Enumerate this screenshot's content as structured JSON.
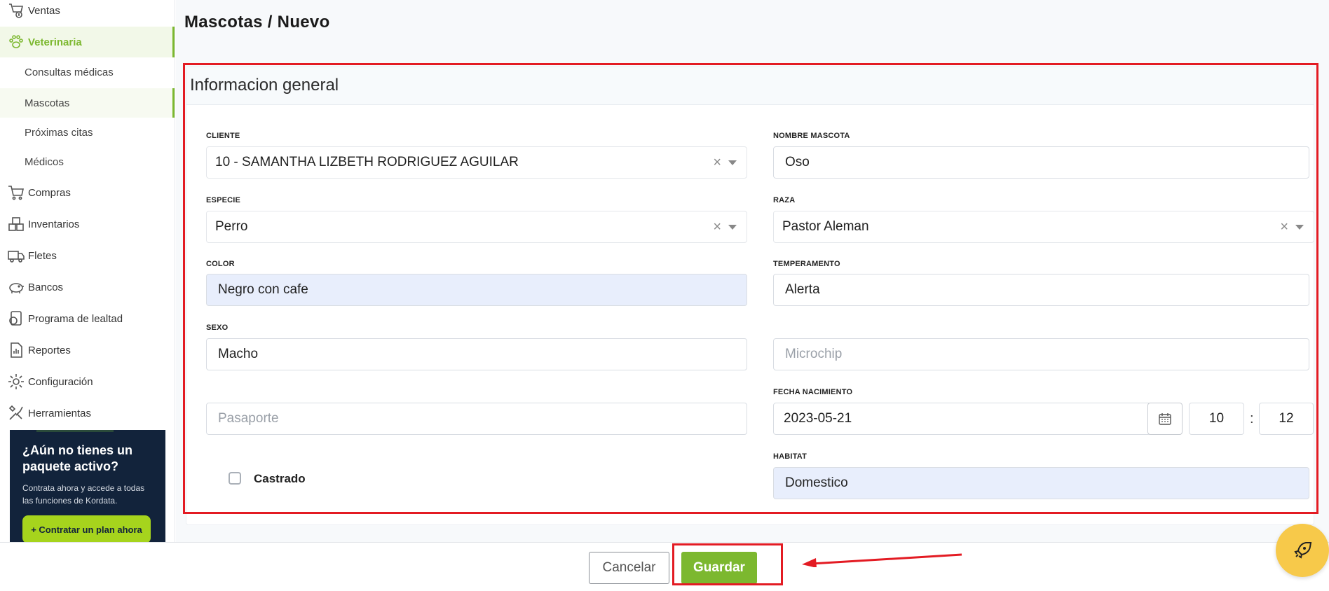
{
  "sidebar": {
    "items": [
      {
        "label": "Ventas",
        "icon": "sales-icon"
      },
      {
        "label": "Veterinaria",
        "icon": "paw-icon"
      },
      {
        "label": "Compras",
        "icon": "cart-icon"
      },
      {
        "label": "Inventarios",
        "icon": "boxes-icon"
      },
      {
        "label": "Fletes",
        "icon": "truck-icon"
      },
      {
        "label": "Bancos",
        "icon": "piggy-bank-icon"
      },
      {
        "label": "Programa de lealtad",
        "icon": "loyalty-icon"
      },
      {
        "label": "Reportes",
        "icon": "report-icon"
      },
      {
        "label": "Configuración",
        "icon": "gear-icon"
      },
      {
        "label": "Herramientas",
        "icon": "tools-icon"
      }
    ],
    "subitems": [
      {
        "label": "Consultas médicas"
      },
      {
        "label": "Mascotas"
      },
      {
        "label": "Próximas citas"
      },
      {
        "label": "Médicos"
      }
    ],
    "promo": {
      "title": "¿Aún no tienes un paquete activo?",
      "text": "Contrata ahora y accede a todas las funciones de Kordata.",
      "cta": "+ Contratar un plan ahora"
    }
  },
  "header": {
    "breadcrumb": "Mascotas /  Nuevo"
  },
  "form": {
    "title": "Informacion general",
    "cliente_label": "CLIENTE",
    "cliente_value": "10 - SAMANTHA LIZBETH RODRIGUEZ AGUILAR",
    "nombre_label": "NOMBRE MASCOTA",
    "nombre_value": "Oso",
    "especie_label": "ESPECIE",
    "especie_value": "Perro",
    "raza_label": "RAZA",
    "raza_value": "Pastor Aleman",
    "color_label": "COLOR",
    "color_value": "Negro con cafe",
    "temperamento_label": "TEMPERAMENTO",
    "temperamento_value": "Alerta",
    "sexo_label": "SEXO",
    "sexo_value": "Macho",
    "microchip_placeholder": "Microchip",
    "pasaporte_placeholder": "Pasaporte",
    "fecha_label": "FECHA NACIMIENTO",
    "fecha_value": "2023-05-21",
    "hora_value": "10",
    "minuto_value": "12",
    "colon": ":",
    "castrado_label": "Castrado",
    "habitat_label": "HABITAT",
    "habitat_value": "Domestico",
    "clear_glyph": "×"
  },
  "footer": {
    "cancel_label": "Cancelar",
    "save_label": "Guardar"
  },
  "colors": {
    "accent": "#7cb82f",
    "annotation": "#e31b23",
    "promo_bg": "#12233b",
    "fab": "#f7c94a"
  }
}
